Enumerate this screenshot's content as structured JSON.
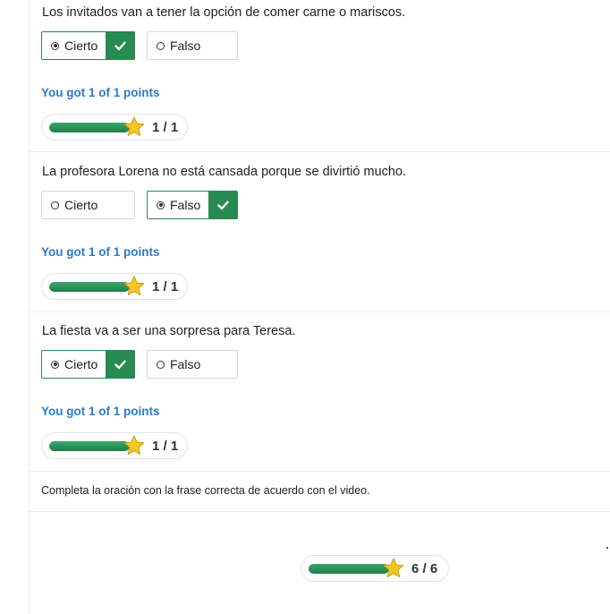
{
  "questions": [
    {
      "text": "Los invitados van a tener la opción de comer carne o mariscos.",
      "options": [
        {
          "label": "Cierto",
          "selected": true,
          "correct": true
        },
        {
          "label": "Falso",
          "selected": false,
          "correct": false
        }
      ],
      "result": "You got 1 of 1 points",
      "score": "1 / 1",
      "progress": 1.0
    },
    {
      "text": "La profesora Lorena no está cansada porque se divirtió mucho.",
      "options": [
        {
          "label": "Cierto",
          "selected": false,
          "correct": false
        },
        {
          "label": "Falso",
          "selected": true,
          "correct": true
        }
      ],
      "result": "You got 1 of 1 points",
      "score": "1 / 1",
      "progress": 1.0
    },
    {
      "text": "La fiesta va a ser una sorpresa para Teresa.",
      "options": [
        {
          "label": "Cierto",
          "selected": true,
          "correct": true
        },
        {
          "label": "Falso",
          "selected": false,
          "correct": false
        }
      ],
      "result": "You got 1 of 1 points",
      "score": "1 / 1",
      "progress": 1.0
    }
  ],
  "instruction": "Completa la oración con la frase correcta de acuerdo con el video.",
  "total": {
    "score": "6 / 6",
    "progress": 1.0
  },
  "colors": {
    "accent_green": "#268a51",
    "link_blue": "#2b7bd0",
    "star": "#f6c623"
  },
  "icons": {
    "check": "check-icon",
    "star": "star-icon",
    "radio": "radio-icon"
  }
}
